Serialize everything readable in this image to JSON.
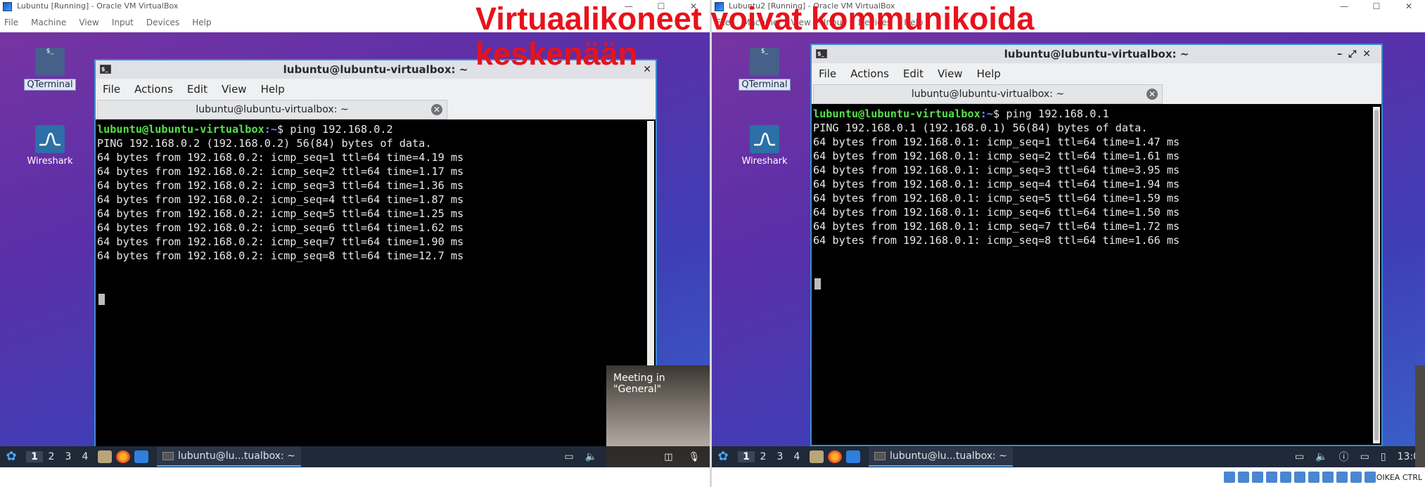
{
  "left_vm": {
    "title": "Lubuntu [Running] - Oracle VM VirtualBox",
    "menu": [
      "File",
      "Machine",
      "View",
      "Input",
      "Devices",
      "Help"
    ],
    "desktop_icons": [
      {
        "label": "QTerminal"
      },
      {
        "label": "Wireshark"
      }
    ],
    "terminal": {
      "title": "lubuntu@lubuntu-virtualbox: ~",
      "menu": [
        "File",
        "Actions",
        "Edit",
        "View",
        "Help"
      ],
      "tab_label": "lubuntu@lubuntu-virtualbox: ~",
      "prompt_user": "lubuntu@lubuntu-virtualbox",
      "prompt_path": ":~",
      "command": "$ ping 192.168.0.2",
      "lines": [
        "PING 192.168.0.2 (192.168.0.2) 56(84) bytes of data.",
        "64 bytes from 192.168.0.2: icmp_seq=1 ttl=64 time=4.19 ms",
        "64 bytes from 192.168.0.2: icmp_seq=2 ttl=64 time=1.17 ms",
        "64 bytes from 192.168.0.2: icmp_seq=3 ttl=64 time=1.36 ms",
        "64 bytes from 192.168.0.2: icmp_seq=4 ttl=64 time=1.87 ms",
        "64 bytes from 192.168.0.2: icmp_seq=5 ttl=64 time=1.25 ms",
        "64 bytes from 192.168.0.2: icmp_seq=6 ttl=64 time=1.62 ms",
        "64 bytes from 192.168.0.2: icmp_seq=7 ttl=64 time=1.90 ms",
        "64 bytes from 192.168.0.2: icmp_seq=8 ttl=64 time=12.7 ms"
      ]
    },
    "taskbar": {
      "workspaces": [
        "1",
        "2",
        "3",
        "4"
      ],
      "task_label": "lubuntu@lu...tualbox: ~"
    },
    "meeting_title": "Meeting in \"General\""
  },
  "right_vm": {
    "title": "Lubuntu2 [Running] - Oracle VM VirtualBox",
    "menu": [
      "File",
      "Machine",
      "View",
      "Input",
      "Devices",
      "Help"
    ],
    "desktop_icons": [
      {
        "label": "QTerminal"
      },
      {
        "label": "Wireshark"
      }
    ],
    "terminal": {
      "title": "lubuntu@lubuntu-virtualbox: ~",
      "menu": [
        "File",
        "Actions",
        "Edit",
        "View",
        "Help"
      ],
      "tab_label": "lubuntu@lubuntu-virtualbox: ~",
      "prompt_user": "lubuntu@lubuntu-virtualbox",
      "prompt_path": ":~",
      "command": "$ ping 192.168.0.1",
      "lines": [
        "PING 192.168.0.1 (192.168.0.1) 56(84) bytes of data.",
        "64 bytes from 192.168.0.1: icmp_seq=1 ttl=64 time=1.47 ms",
        "64 bytes from 192.168.0.1: icmp_seq=2 ttl=64 time=1.61 ms",
        "64 bytes from 192.168.0.1: icmp_seq=3 ttl=64 time=3.95 ms",
        "64 bytes from 192.168.0.1: icmp_seq=4 ttl=64 time=1.94 ms",
        "64 bytes from 192.168.0.1: icmp_seq=5 ttl=64 time=1.59 ms",
        "64 bytes from 192.168.0.1: icmp_seq=6 ttl=64 time=1.50 ms",
        "64 bytes from 192.168.0.1: icmp_seq=7 ttl=64 time=1.72 ms",
        "64 bytes from 192.168.0.1: icmp_seq=8 ttl=64 time=1.66 ms"
      ]
    },
    "taskbar": {
      "workspaces": [
        "1",
        "2",
        "3",
        "4"
      ],
      "task_label": "lubuntu@lu...tualbox: ~",
      "clock": "13:0"
    },
    "host_key": "OIKEA CTRL"
  },
  "overlay_caption": {
    "line1": "Virtuaalikoneet voivat kommunikoida",
    "line2": "keskenään"
  },
  "colors": {
    "prompt_user": "#55e04a",
    "prompt_path": "#6a8cff",
    "overlay": "#e8121b",
    "terminal_border": "#3c8cd2"
  }
}
